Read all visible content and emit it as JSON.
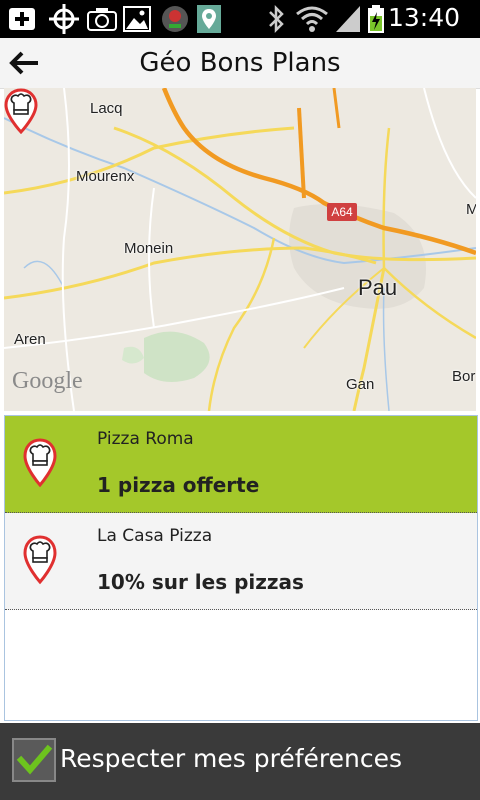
{
  "status_bar": {
    "time": "13:40",
    "icons": [
      "add-icon",
      "gps-icon",
      "camera-icon",
      "image-icon",
      "app-icon",
      "map-pin-icon",
      "bluetooth-icon",
      "wifi-icon",
      "signal-icon",
      "battery-icon"
    ]
  },
  "header": {
    "title": "Géo Bons Plans",
    "back_icon": "arrow-left-icon"
  },
  "map": {
    "labels": [
      "Lacq",
      "Mourenx",
      "Monein",
      "Aren",
      "Pau",
      "Gan",
      "Bor",
      "M"
    ],
    "road_badge": "A64",
    "google_logo": "Google"
  },
  "list": {
    "items": [
      {
        "name": "Pizza Roma",
        "offer": "1 pizza offerte",
        "selected": true
      },
      {
        "name": "La Casa Pizza",
        "offer": "10% sur les pizzas",
        "selected": false
      }
    ]
  },
  "footer": {
    "checkbox_label": "Respecter mes préférences",
    "checked": true
  },
  "colors": {
    "selected_row": "#a4c82a",
    "pin_red": "#e03030",
    "check_green": "#6dc31e"
  }
}
